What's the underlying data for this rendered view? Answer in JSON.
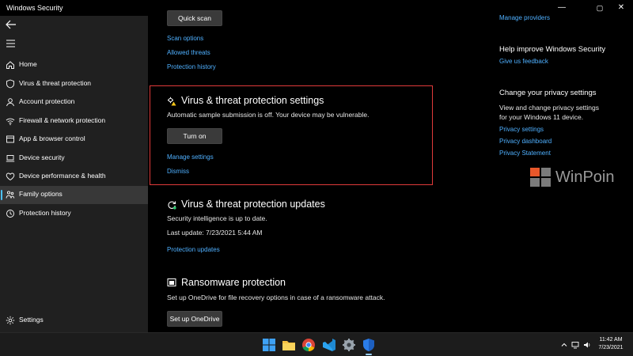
{
  "window": {
    "title": "Windows Security",
    "controls": {
      "minimize": "—",
      "maximize": "▢",
      "close": "✕"
    }
  },
  "sidebar": {
    "items": [
      {
        "label": "Home",
        "icon": "home-icon"
      },
      {
        "label": "Virus & threat protection",
        "icon": "shield-icon"
      },
      {
        "label": "Account protection",
        "icon": "person-icon"
      },
      {
        "label": "Firewall & network protection",
        "icon": "wifi-icon"
      },
      {
        "label": "App & browser control",
        "icon": "app-window-icon"
      },
      {
        "label": "Device security",
        "icon": "laptop-icon"
      },
      {
        "label": "Device performance & health",
        "icon": "heart-icon"
      },
      {
        "label": "Family options",
        "icon": "family-icon"
      },
      {
        "label": "Protection history",
        "icon": "history-icon"
      }
    ],
    "selected": "Family options",
    "settings_label": "Settings"
  },
  "scan": {
    "quick_scan_label": "Quick scan",
    "links": [
      "Scan options",
      "Allowed threats",
      "Protection history"
    ]
  },
  "settings_section": {
    "title": "Virus & threat protection settings",
    "description": "Automatic sample submission is off. Your device may be vulnerable.",
    "button_label": "Turn on",
    "manage_link": "Manage settings",
    "dismiss_link": "Dismiss"
  },
  "updates_section": {
    "title": "Virus & threat protection updates",
    "status": "Security intelligence is up to date.",
    "last_update": "Last update: 7/23/2021 5:44 AM",
    "link": "Protection updates"
  },
  "ransomware_section": {
    "title": "Ransomware protection",
    "description": "Set up OneDrive for file recovery options in case of a ransomware attack.",
    "button_label": "Set up OneDrive"
  },
  "right_panel": {
    "manage_providers": "Manage providers",
    "help_title": "Help improve Windows Security",
    "feedback_link": "Give us feedback",
    "privacy_title": "Change your privacy settings",
    "privacy_desc_1": "View and change privacy settings",
    "privacy_desc_2": "for your Windows 11 device.",
    "privacy_links": [
      "Privacy settings",
      "Privacy dashboard",
      "Privacy Statement"
    ]
  },
  "watermark": {
    "text": "WinPoin"
  },
  "taskbar": {
    "apps": [
      "windows-start-icon",
      "file-explorer-icon",
      "chrome-icon",
      "vscode-icon",
      "settings-gear-icon",
      "windows-security-icon"
    ],
    "time": "11:42 AM",
    "date": "7/23/2021"
  },
  "colors": {
    "accent": "#4fb0ff",
    "sidebar_bg": "#202020",
    "highlight_border": "#e03a3a",
    "selected_bg": "#383838"
  }
}
